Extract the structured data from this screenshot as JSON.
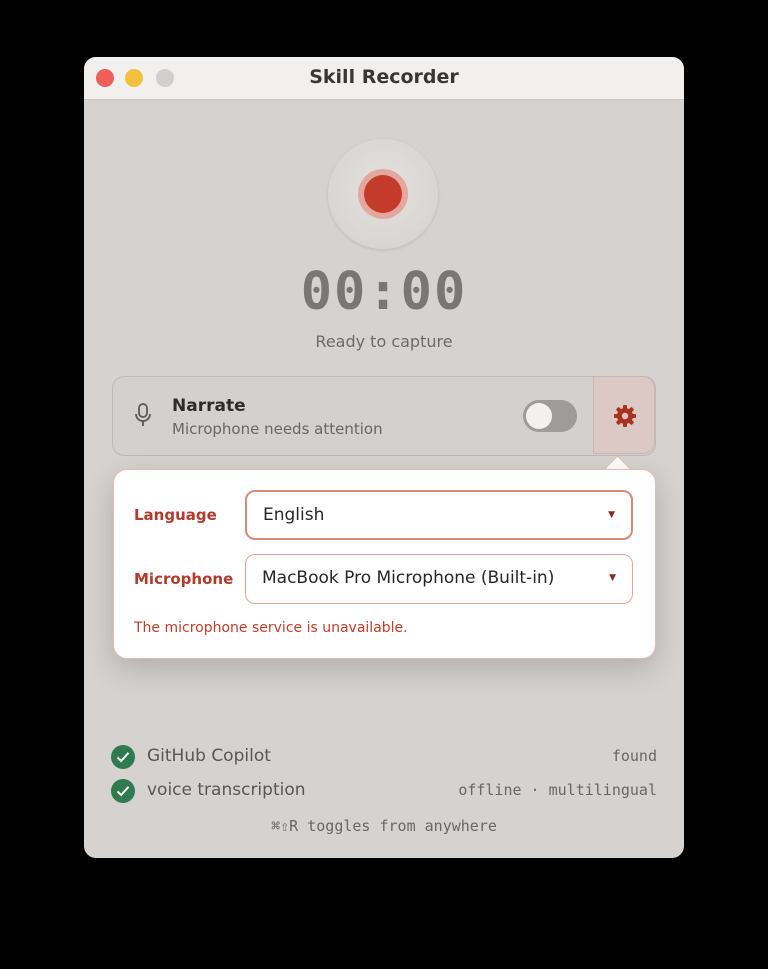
{
  "window": {
    "title": "Skill Recorder"
  },
  "recorder": {
    "timer": "00:00",
    "status": "Ready to capture"
  },
  "narrate": {
    "title": "Narrate",
    "subtitle": "Microphone needs attention",
    "enabled": false
  },
  "settings": {
    "language_label": "Language",
    "language_value": "English",
    "microphone_label": "Microphone",
    "microphone_value": "MacBook Pro Microphone (Built-in)",
    "error": "The microphone service is unavailable."
  },
  "checks": [
    {
      "label": "GitHub Copilot",
      "value": "found"
    },
    {
      "label": "voice transcription",
      "value": "offline · multilingual"
    }
  ],
  "hint": "⌘⇧R toggles from anywhere",
  "colors": {
    "accent": "#c43a2b",
    "success": "#2f7a4e",
    "window_bg": "#d6d2d0"
  }
}
